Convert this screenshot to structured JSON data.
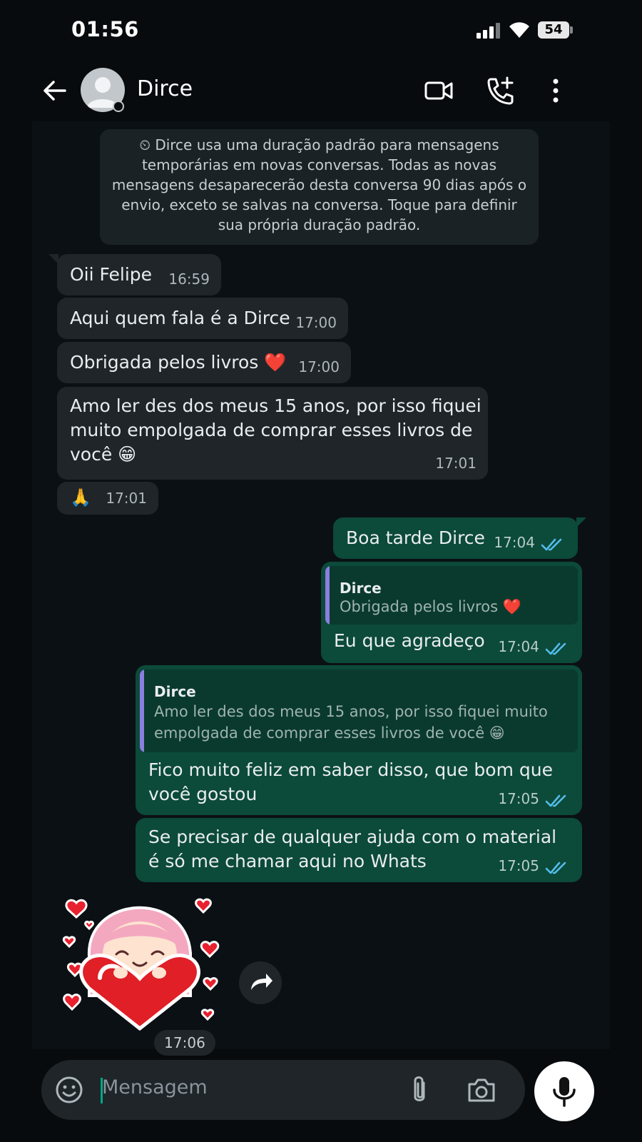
{
  "status_bar": {
    "time": "01:56",
    "battery": "54"
  },
  "header": {
    "contact_name": "Dirce"
  },
  "notice": {
    "text": "⏲ Dirce usa uma duração padrão para mensagens temporárias em novas conversas. Todas as novas mensagens desaparecerão desta conversa 90 dias após o envio, exceto se salvas na conversa. Toque para definir sua própria duração padrão."
  },
  "messages": [
    {
      "dir": "in",
      "text": "Oii Felipe",
      "time": "16:59"
    },
    {
      "dir": "in",
      "text": "Aqui quem fala é a Dirce",
      "time": "17:00"
    },
    {
      "dir": "in",
      "text": "Obrigada pelos livros ❤️",
      "time": "17:00"
    },
    {
      "dir": "in",
      "text_lines": [
        "Amo ler des dos meus 15 anos, por isso fiquei",
        "muito empolgada de comprar esses livros de",
        "você 😁"
      ],
      "time": "17:01"
    },
    {
      "dir": "in",
      "text": "🙏",
      "time": "17:01"
    },
    {
      "dir": "out",
      "text": "Boa tarde Dirce",
      "time": "17:04"
    },
    {
      "dir": "out",
      "quote_author": "Dirce",
      "quote_text": "Obrigada pelos livros ❤️",
      "text": "Eu que agradeço",
      "time": "17:04"
    },
    {
      "dir": "out",
      "quote_author": "Dirce",
      "quote_lines": [
        "Amo ler des dos meus 15 anos, por isso fiquei muito",
        "empolgada de comprar esses livros de você 😁"
      ],
      "text_lines": [
        "Fico muito feliz em saber disso, que bom que",
        "você gostou"
      ],
      "time": "17:05"
    },
    {
      "dir": "out",
      "text_lines": [
        "Se precisar de qualquer ajuda com o material",
        "é só me chamar aqui no Whats"
      ],
      "time": "17:05"
    },
    {
      "dir": "in",
      "sticker": "girl-hugging-heart",
      "time": "17:06"
    }
  ],
  "input": {
    "placeholder": "Mensagem"
  },
  "colors": {
    "incoming": "#1f2529",
    "outgoing": "#0c4a3a",
    "accent": "#00a884",
    "read_ticks": "#53bdeb"
  }
}
